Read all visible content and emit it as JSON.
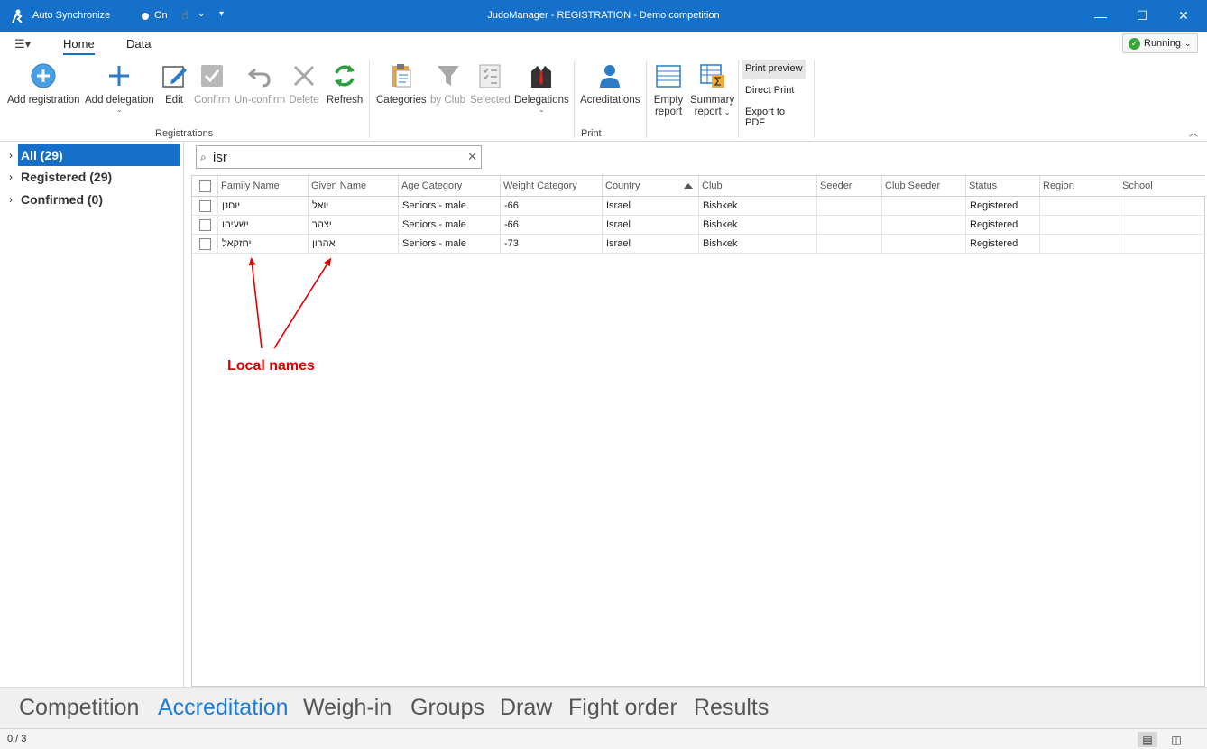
{
  "titlebar": {
    "autosync_label": "Auto Synchronize",
    "on_label": "On",
    "title": "JudoManager - REGISTRATION - Demo competition"
  },
  "ribbon_tabs": {
    "tabs": [
      "Home",
      "Data"
    ],
    "active": "Home",
    "status_label": "Running"
  },
  "ribbon": {
    "registrations_group": "Registrations",
    "print_group": "Print",
    "buttons": {
      "add_registration": "Add registration",
      "add_delegation": "Add delegation",
      "edit": "Edit",
      "confirm": "Confirm",
      "unconfirm": "Un-confirm",
      "delete": "Delete",
      "refresh": "Refresh",
      "categories": "Categories",
      "by_club": "by Club",
      "selected": "Selected",
      "delegations": "Delegations",
      "acreditations": "Acreditations",
      "empty_report_1": "Empty",
      "empty_report_2": "report",
      "summary_report_1": "Summary",
      "summary_report_2": "report",
      "print_preview": "Print preview",
      "direct_print": "Direct Print",
      "export_pdf": "Export to PDF"
    }
  },
  "tree": {
    "items": [
      {
        "label": "All (29)"
      },
      {
        "label": "Registered (29)"
      },
      {
        "label": "Confirmed (0)"
      }
    ]
  },
  "search": {
    "value": "isr"
  },
  "grid": {
    "columns": [
      "Family Name",
      "Given Name",
      "Age Category",
      "Weight Category",
      "Country",
      "Club",
      "Seeder",
      "Club Seeder",
      "Status",
      "Region",
      "School"
    ],
    "sorted_column": "Country",
    "rows": [
      {
        "family": "יוחנן",
        "given": "יואל",
        "age": "Seniors - male",
        "weight": "-66",
        "country": "Israel",
        "club": "Bishkek",
        "seeder": "",
        "club_seeder": "",
        "status": "Registered",
        "region": "",
        "school": ""
      },
      {
        "family": "ישעיהו",
        "given": "יצהר",
        "age": "Seniors - male",
        "weight": "-66",
        "country": "Israel",
        "club": "Bishkek",
        "seeder": "",
        "club_seeder": "",
        "status": "Registered",
        "region": "",
        "school": ""
      },
      {
        "family": "יחזקאל",
        "given": "אהרון",
        "age": "Seniors - male",
        "weight": "-73",
        "country": "Israel",
        "club": "Bishkek",
        "seeder": "",
        "club_seeder": "",
        "status": "Registered",
        "region": "",
        "school": ""
      }
    ]
  },
  "annotation": {
    "label": "Local names",
    "color": "#e00000"
  },
  "bottom_nav": {
    "items": [
      "Competition",
      "Accreditation",
      "Weigh-in",
      "Groups",
      "Draw",
      "Fight order",
      "Results"
    ],
    "active": "Accreditation"
  },
  "statusbar": {
    "count": "0 / 3"
  },
  "colors": {
    "accent": "#1470c8",
    "active_nav": "#1f7cd6"
  }
}
